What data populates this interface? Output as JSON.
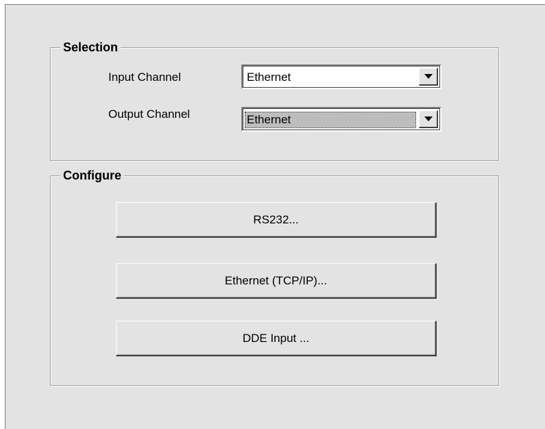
{
  "selection": {
    "title": "Selection",
    "input_channel": {
      "label": "Input Channel",
      "value": "Ethernet"
    },
    "output_channel": {
      "label": "Output Channel",
      "value": "Ethernet"
    }
  },
  "configure": {
    "title": "Configure",
    "buttons": {
      "rs232": "RS232...",
      "ethernet": "Ethernet (TCP/IP)...",
      "dde": "DDE Input ..."
    }
  }
}
